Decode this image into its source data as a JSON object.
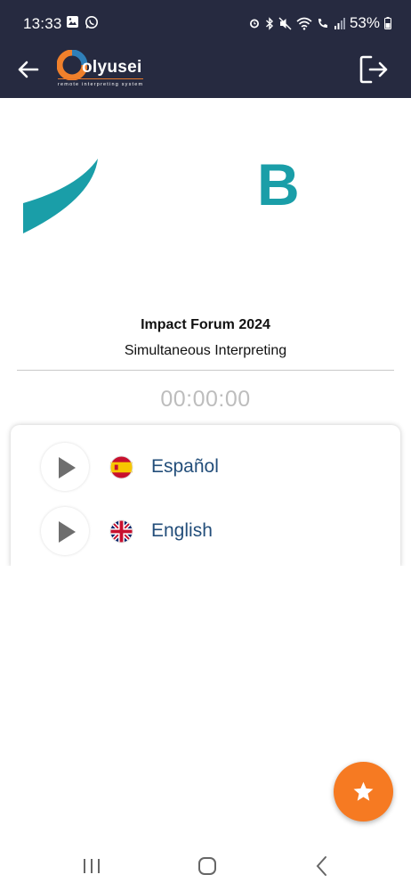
{
  "status_bar": {
    "time": "13:33",
    "battery": "53%",
    "icons_left": [
      "gallery-icon",
      "whatsapp-icon"
    ],
    "icons_right": [
      "alarm-icon",
      "bluetooth-icon",
      "mute-icon",
      "wifi-icon",
      "wifi-calling-icon",
      "signal-icon",
      "battery-icon"
    ]
  },
  "app_bar": {
    "logo_text": "olyusei",
    "logo_tagline": "remote interpreting system",
    "back_icon": "arrow-left-icon",
    "exit_icon": "logout-icon"
  },
  "colors": {
    "header_bg": "#262a40",
    "accent_orange": "#f67a22",
    "banner_teal": "#1a9ea8",
    "language_text": "#234e7a",
    "timer_text": "#bdbdbd"
  },
  "event": {
    "title": "Impact Forum 2024",
    "subtitle": "Simultaneous Interpreting",
    "timer": "00:00:00"
  },
  "banner": {
    "letter": "B"
  },
  "languages": [
    {
      "label": "Español",
      "flag": "spain-flag-icon"
    },
    {
      "label": "English",
      "flag": "uk-flag-icon"
    }
  ],
  "fab": {
    "icon": "star-icon"
  },
  "nav": {
    "buttons": [
      "recents-icon",
      "home-icon",
      "back-icon"
    ]
  }
}
